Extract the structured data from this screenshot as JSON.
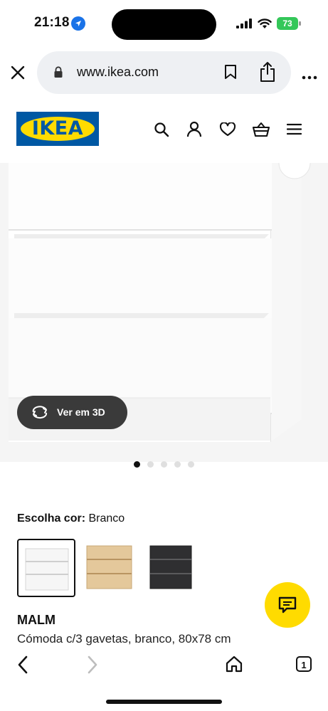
{
  "status_bar": {
    "time": "21:18",
    "battery": "73"
  },
  "browser": {
    "url": "www.ikea.com"
  },
  "header": {
    "logo": "IKEA"
  },
  "product_image": {
    "view_3d_label": "Ver em 3D",
    "carousel_total": 5,
    "carousel_active": 1
  },
  "colors": {
    "label": "Escolha cor:",
    "selected": "Branco",
    "options": [
      "Branco",
      "Efeito carvalho c/velatura branca",
      "Preto-castanho"
    ]
  },
  "product": {
    "name": "MALM",
    "description": "Cómoda c/3 gavetas, branco, 80x78 cm"
  },
  "bottom_bar": {
    "tabs_count": "1"
  },
  "theme": {
    "ikea_blue": "#0058a3",
    "ikea_yellow": "#ffdb00"
  }
}
